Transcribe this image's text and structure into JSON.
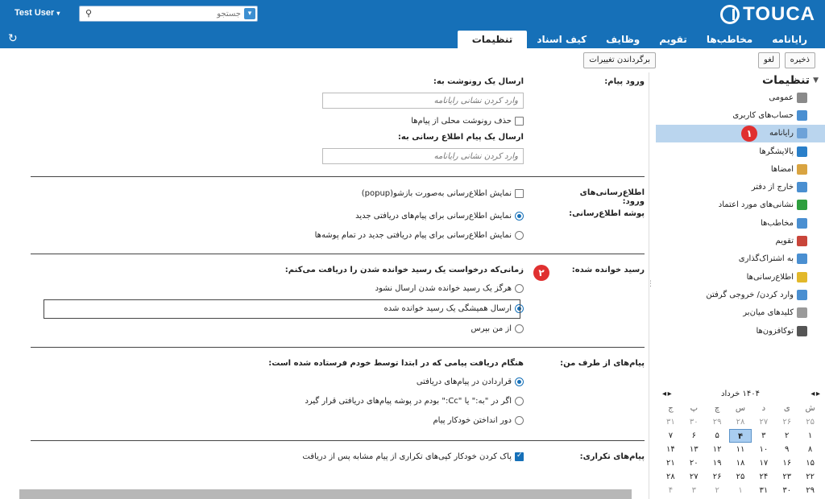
{
  "header": {
    "logo": "TOUCA",
    "user": "Test User",
    "search_placeholder": "جستجو"
  },
  "nav": {
    "tabs": [
      "رایانامه",
      "مخاطب‌ها",
      "تقویم",
      "وظایف",
      "کیف اسناد",
      "تنظیمات"
    ],
    "active": "تنظیمات"
  },
  "toolbar": {
    "save": "ذخیره",
    "cancel": "لغو",
    "revert": "برگرداندن تغییرات"
  },
  "sidebar": {
    "title": "تنظیمات",
    "items": [
      {
        "label": "عمومی",
        "icon": "gear-icon",
        "color": "#8a8a8a"
      },
      {
        "label": "حساب‌های کاربری",
        "icon": "accounts-icon",
        "color": "#4a8fd1"
      },
      {
        "label": "رایانامه",
        "icon": "mail-icon",
        "color": "#6da2d8",
        "active": true
      },
      {
        "label": "پالایشگرها",
        "icon": "filter-icon",
        "color": "#2a7fc9"
      },
      {
        "label": "امضاها",
        "icon": "signature-icon",
        "color": "#d9a441"
      },
      {
        "label": "خارج از دفتر",
        "icon": "clock-icon",
        "color": "#4a8fd1"
      },
      {
        "label": "نشانی‌های مورد اعتماد",
        "icon": "shield-icon",
        "color": "#2e9e3e"
      },
      {
        "label": "مخاطب‌ها",
        "icon": "contact-icon",
        "color": "#4a8fd1"
      },
      {
        "label": "تقویم",
        "icon": "calendar-icon",
        "color": "#c9453a"
      },
      {
        "label": "به اشتراک‌گذاری",
        "icon": "share-icon",
        "color": "#4a8fd1"
      },
      {
        "label": "اطلاع‌رسانی‌ها",
        "icon": "bell-icon",
        "color": "#e2b82a"
      },
      {
        "label": "وارد کردن/ خروجی گرفتن",
        "icon": "import-export-icon",
        "color": "#4a8fd1"
      },
      {
        "label": "کلیدهای میان‌بر",
        "icon": "keyboard-icon",
        "color": "#9a9a9a"
      },
      {
        "label": "توکافزون‌ها",
        "icon": "zimlet-icon",
        "color": "#555555"
      }
    ],
    "badge": "۱"
  },
  "calendar": {
    "month": "۱۴۰۴ خرداد",
    "day_names": [
      "ش",
      "ی",
      "د",
      "س",
      "چ",
      "پ",
      "ج"
    ],
    "weeks": [
      [
        "۲۵",
        "۲۶",
        "۲۷",
        "۲۸",
        "۲۹",
        "۳۰",
        "۳۱"
      ],
      [
        "۱",
        "۲",
        "۳",
        "۴",
        "۵",
        "۶",
        "۷"
      ],
      [
        "۸",
        "۹",
        "۱۰",
        "۱۱",
        "۱۲",
        "۱۳",
        "۱۴"
      ],
      [
        "۱۵",
        "۱۶",
        "۱۷",
        "۱۸",
        "۱۹",
        "۲۰",
        "۲۱"
      ],
      [
        "۲۲",
        "۲۳",
        "۲۴",
        "۲۵",
        "۲۶",
        "۲۷",
        "۲۸"
      ],
      [
        "۲۹",
        "۳۰",
        "۳۱",
        "۱",
        "۲",
        "۳",
        "۴"
      ]
    ],
    "today": "۴"
  },
  "form": {
    "incoming_label": "ورود پیام:",
    "send_copy_label": "ارسال یک رونوشت به:",
    "copy_placeholder": "وارد کردن نشانی رایانامه",
    "delete_local_copy": "حذف رونوشت محلی از پیام‌ها",
    "send_notify_label": "ارسال یک پیام اطلاع رسانی به:",
    "notify_placeholder": "وارد کردن نشانی رایانامه",
    "arrival_notify_label": "اطلاع‌رسانی‌های ورود:",
    "popup_notify": "نمایش اطلاع‌رسانی به‌صورت بازشو(popup)",
    "notify_folder_label": "پوشه اطلاع‌رسانی:",
    "notify_new_inbox": "نمایش اطلاع‌رسانی برای پیام‌های دریافتی جدید",
    "notify_new_all": "نمایش اطلاع‌رسانی برای پیام دریافتی جدید در تمام پوشه‌ها",
    "read_receipt_label": "رسید خوانده شده:",
    "read_receipt_question": "زمانی‌که درخواست یک رسید خوانده شدن را دریافت می‌کنم:",
    "rr_never": "هرگز یک رسید خوانده شدن ارسال نشود",
    "rr_always": "ارسال همیشگی یک رسید خوانده شده",
    "rr_ask": "از من بپرس",
    "badge": "۲",
    "from_me_label": "پیام‌های از طرف من:",
    "from_me_question": "هنگام دریافت پیامی که در ابتدا توسط خودم فرستاده شده است:",
    "fm_inbox": "قراردادن در پیام‌های دریافتی",
    "fm_cc": "اگر در \"به:\" یا \"Cc:\" بودم در پوشه پیام‌های دریافتی قرار گیرد",
    "fm_discard": "دور انداختن خودکار پیام",
    "dup_label": "پیام‌های تکراری:",
    "dup_option": "پاک کردن خودکار کپی‌های تکراری از پیام مشابه پس از دریافت"
  }
}
